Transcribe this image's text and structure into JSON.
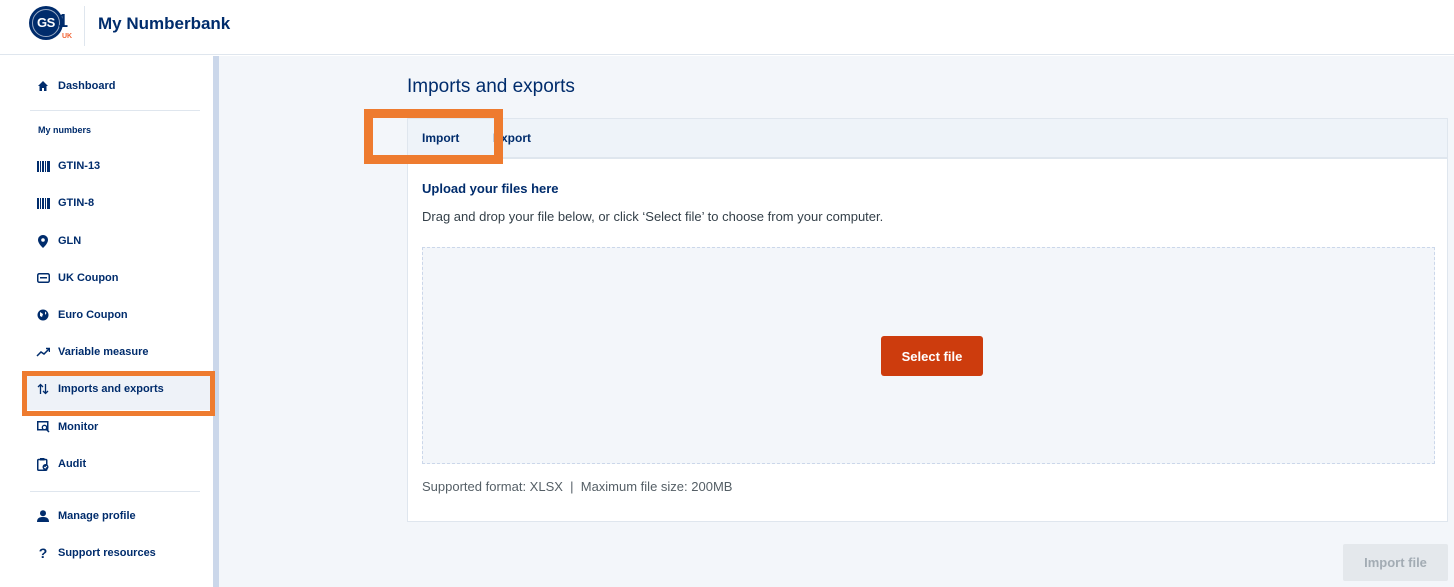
{
  "header": {
    "logo_text": "GS1",
    "logo_one": "1",
    "logo_region": "UK",
    "title": "My Numberbank"
  },
  "sidebar": {
    "dashboard": "Dashboard",
    "section_label": "My numbers",
    "items": [
      {
        "label": "GTIN-13",
        "icon": "barcode-icon"
      },
      {
        "label": "GTIN-8",
        "icon": "barcode-icon"
      },
      {
        "label": "GLN",
        "icon": "location-pin-icon"
      },
      {
        "label": "UK Coupon",
        "icon": "coupon-icon"
      },
      {
        "label": "Euro Coupon",
        "icon": "globe-icon"
      },
      {
        "label": "Variable measure",
        "icon": "trend-icon"
      },
      {
        "label": "Imports and exports",
        "icon": "swap-arrows-icon"
      },
      {
        "label": "Monitor",
        "icon": "monitor-search-icon"
      },
      {
        "label": "Audit",
        "icon": "audit-icon"
      }
    ],
    "manage_profile": "Manage profile",
    "support_resources": "Support resources",
    "active_item": "Imports and exports"
  },
  "main": {
    "page_title": "Imports and exports",
    "tabs": [
      {
        "label": "Import",
        "active": true
      },
      {
        "label": "Export",
        "active": false
      }
    ],
    "upload_heading": "Upload your files here",
    "upload_description": "Drag and drop your file below, or click ‘Select file’ to choose from your computer.",
    "select_file_label": "Select file",
    "supported_note": "Supported format: XLSX  |  Maximum file size: 200MB",
    "import_file_label": "Import file"
  },
  "colors": {
    "brand_navy": "#002c6c",
    "brand_orange": "#cd3c0d",
    "highlight_orange": "#ee7b2f",
    "disabled_bg": "#e4e8ec"
  }
}
